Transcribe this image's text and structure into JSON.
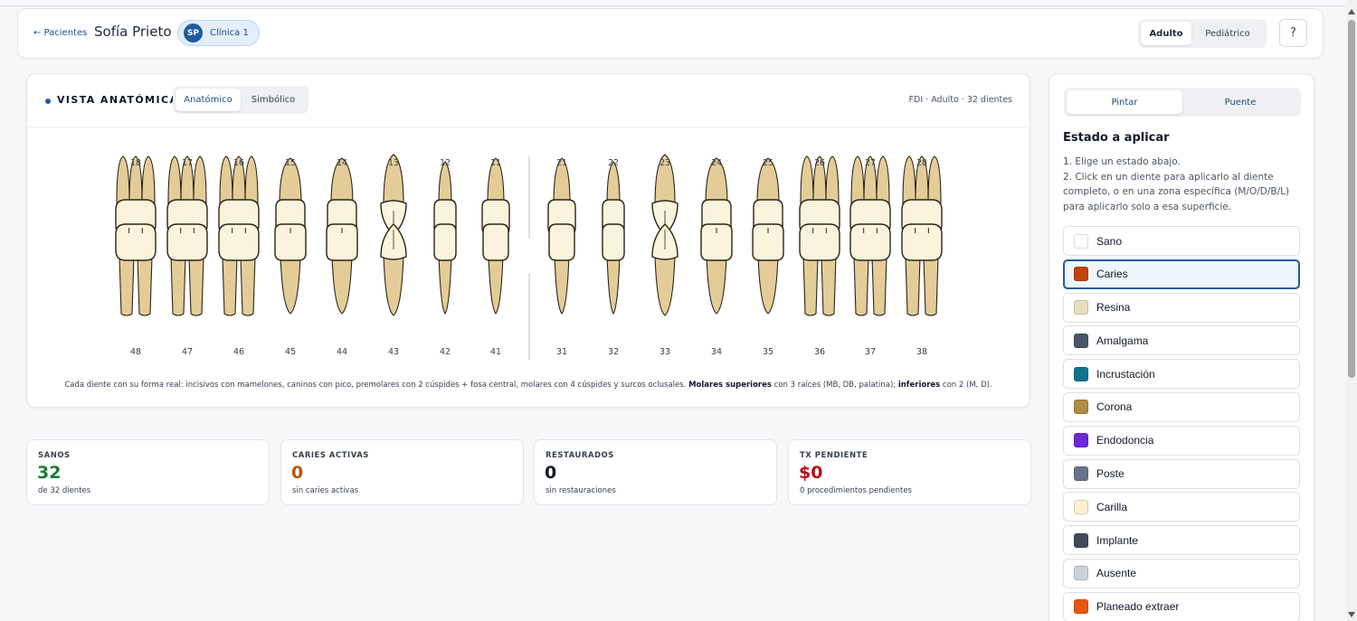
{
  "header": {
    "back_label": "← Pacientes",
    "patient_name": "Sofía Prieto",
    "clinic_initials": "SP",
    "clinic_name": "Clínica 1",
    "mode_adult": "Adulto",
    "mode_pediatric": "Pediátrico",
    "help_label": "?"
  },
  "chart": {
    "title": "VISTA ANATÓMICA",
    "view_anatomic": "Anatómico",
    "view_symbolic": "Simbólico",
    "meta": "FDI · Adulto · 32 dientes",
    "upper_teeth": [
      "18",
      "17",
      "16",
      "15",
      "14",
      "13",
      "12",
      "11",
      "21",
      "22",
      "23",
      "24",
      "25",
      "26",
      "27",
      "28"
    ],
    "lower_teeth": [
      "48",
      "47",
      "46",
      "45",
      "44",
      "43",
      "42",
      "41",
      "31",
      "32",
      "33",
      "34",
      "35",
      "36",
      "37",
      "38"
    ],
    "caption_part1": "Cada diente con su forma real: incisivos con mamelones, caninos con pico, premolares con 2 cúspides + fosa central, molares con 4 cúspides y surcos oclusales. ",
    "caption_bold1": "Molares superiores",
    "caption_part2": " con 3 raíces (MB, DB, palatina); ",
    "caption_bold2": "inferiores",
    "caption_part3": " con 2 (M, D).",
    "tooth_crown_color": "#fbf3dc",
    "tooth_root_color": "#e3cc98"
  },
  "stats": [
    {
      "label": "SANOS",
      "value": "32",
      "sub": "de 32 dientes",
      "color": "#1e7a34"
    },
    {
      "label": "CARIES ACTIVAS",
      "value": "0",
      "sub": "sin caries activas",
      "color": "#b8560d"
    },
    {
      "label": "RESTAURADOS",
      "value": "0",
      "sub": "sin restauraciones",
      "color": "#111827"
    },
    {
      "label": "TX PENDIENTE",
      "value": "$0",
      "sub": "0 procedimientos pendientes",
      "color": "#b3121b"
    }
  ],
  "panel": {
    "tool_paint": "Pintar",
    "tool_bridge": "Puente",
    "estado_title": "Estado a aplicar",
    "instr1": "1. Elige un estado abajo.",
    "instr2": "2. Click en un diente para aplicarlo al diente completo, o en una zona específica (M/O/D/B/L) para aplicarlo solo a esa superficie.",
    "states": [
      {
        "label": "Sano",
        "color": "#ffffff"
      },
      {
        "label": "Caries",
        "color": "#c2410c"
      },
      {
        "label": "Resina",
        "color": "#e8dcbf"
      },
      {
        "label": "Amalgama",
        "color": "#475569"
      },
      {
        "label": "Incrustación",
        "color": "#0e7490"
      },
      {
        "label": "Corona",
        "color": "#b08d45"
      },
      {
        "label": "Endodoncia",
        "color": "#6d28d9"
      },
      {
        "label": "Poste",
        "color": "#64748b"
      },
      {
        "label": "Carilla",
        "color": "#fdf1d2"
      },
      {
        "label": "Implante",
        "color": "#3f4a5a"
      },
      {
        "label": "Ausente",
        "color": "#cbd2dc"
      },
      {
        "label": "Planeado extraer",
        "color": "#e8560f"
      }
    ],
    "selected_state": "Caries"
  }
}
